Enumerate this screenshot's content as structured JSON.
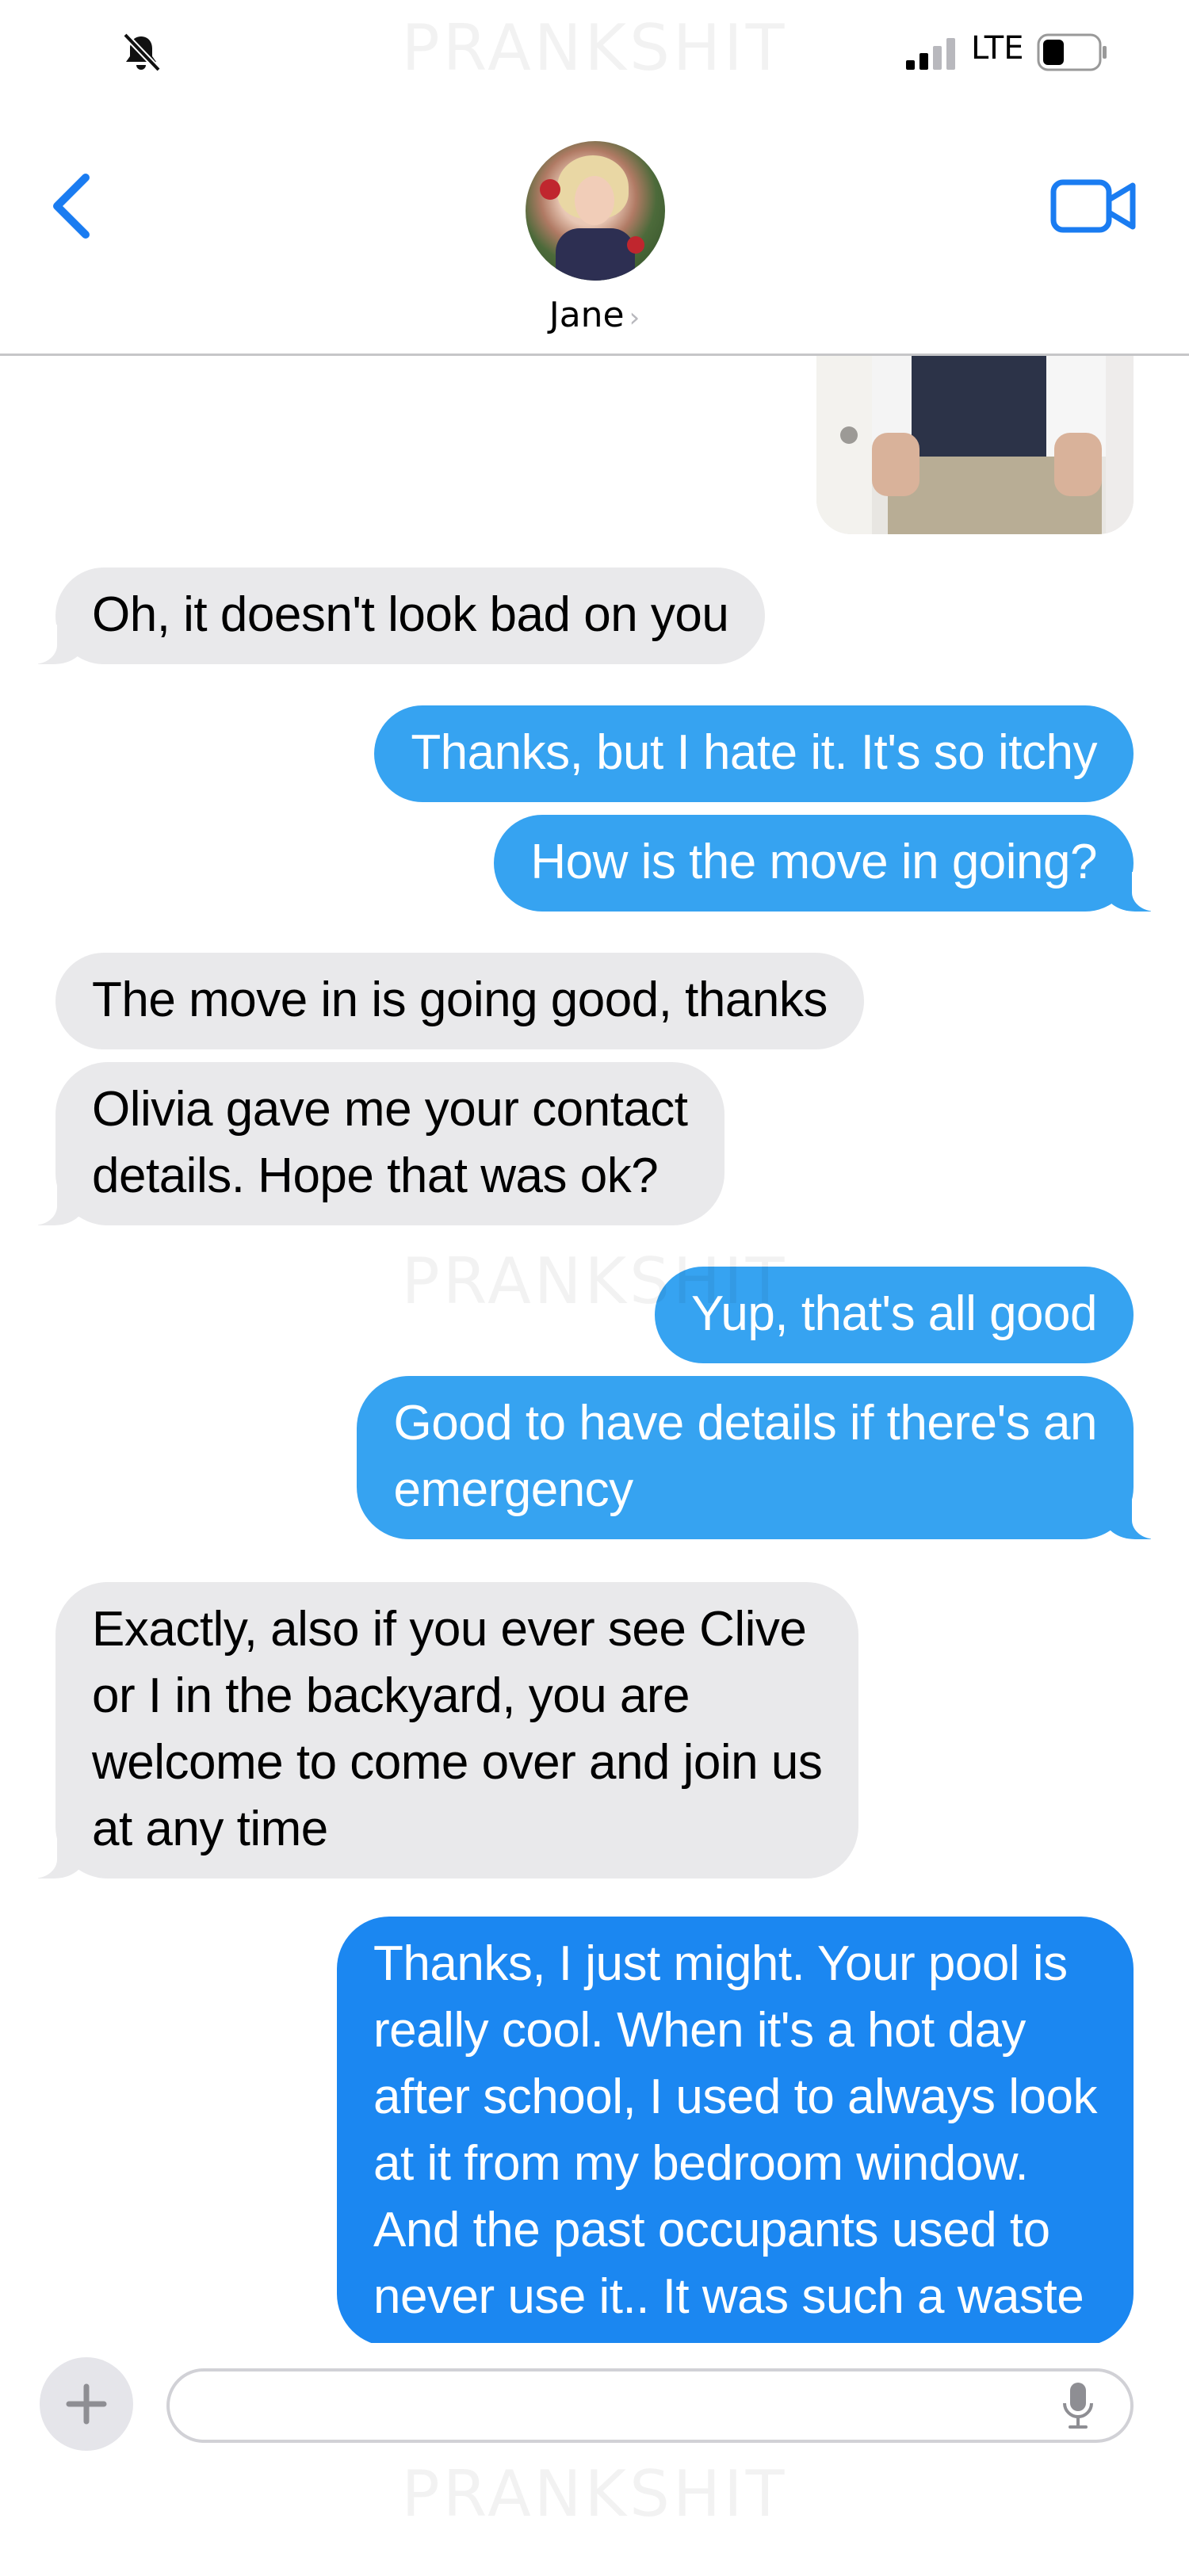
{
  "status_bar": {
    "carrier": "LTE",
    "mute_icon": "bell-slash-icon",
    "signal_icon": "signal-bars-icon",
    "battery_icon": "battery-icon"
  },
  "watermark": "PRANKSHIT",
  "header": {
    "contact_name": "Jane",
    "back_icon": "chevron-left-icon",
    "video_icon": "video-camera-icon",
    "accent_color": "#1a7cf1"
  },
  "conversation": {
    "messages": [
      {
        "from": "contact",
        "text": "Oh, it doesn't look bad on you"
      },
      {
        "from": "me",
        "text": "Thanks, but I hate it. It's so itchy"
      },
      {
        "from": "me",
        "text": "How is the move in going?"
      },
      {
        "from": "contact",
        "text": "The move in is going good, thanks"
      },
      {
        "from": "contact",
        "text": "Olivia gave me your contact\ndetails. Hope that was ok?"
      },
      {
        "from": "me",
        "text": "Yup, that's all good"
      },
      {
        "from": "me",
        "text": "Good to have details if there's an\nemergency"
      },
      {
        "from": "contact",
        "text": "Exactly, also if you ever see Clive\nor I in the backyard, you are\nwelcome to come over and join us\nat any time"
      },
      {
        "from": "me",
        "text": "Thanks, I just might. Your pool is\nreally cool. When it's a hot day\nafter school, I used to always look\nat it from my bedroom window.\nAnd the past occupants used to\nnever use it.. It was such a waste"
      }
    ]
  },
  "input_bar": {
    "plus_icon": "plus-icon",
    "mic_icon": "microphone-icon",
    "placeholder": ""
  },
  "colors": {
    "incoming_bubble": "#e9e9eb",
    "outgoing_bubble": "#36a3f1",
    "outgoing_latest": "#1b87f1"
  }
}
